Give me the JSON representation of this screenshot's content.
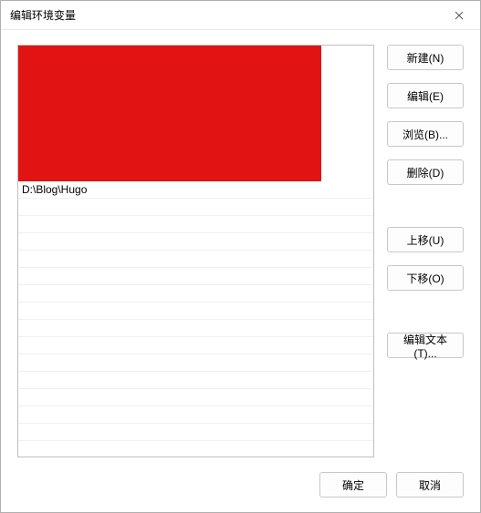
{
  "titlebar": {
    "title": "编辑环境变量"
  },
  "list": {
    "visible_item": "D:\\Blog\\Hugo"
  },
  "buttons": {
    "new": "新建(N)",
    "edit": "编辑(E)",
    "browse": "浏览(B)...",
    "delete": "删除(D)",
    "move_up": "上移(U)",
    "move_down": "下移(O)",
    "edit_text": "编辑文本(T)...",
    "ok": "确定",
    "cancel": "取消"
  }
}
